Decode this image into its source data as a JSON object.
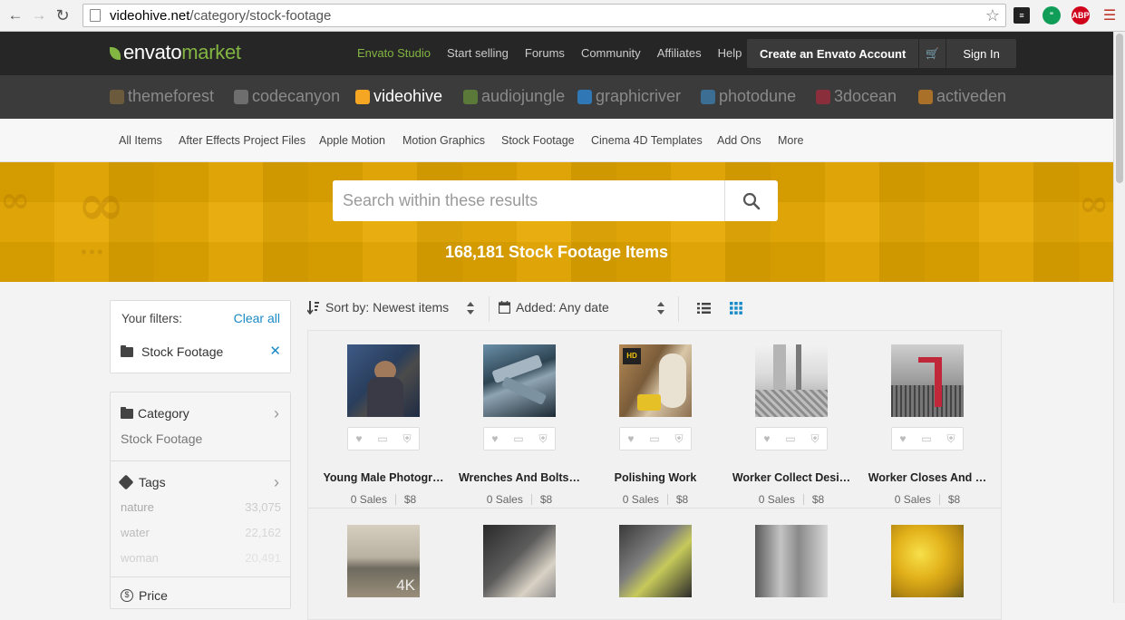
{
  "browser": {
    "url_host": "videohive.net",
    "url_path": "/category/stock-footage",
    "extensions": [
      "stack-icon",
      "hangouts-icon",
      "ABP",
      "menu-icon"
    ]
  },
  "topbar": {
    "logo_envato": "envato",
    "logo_market": "market",
    "links": [
      {
        "label": "Envato Studio",
        "active": true
      },
      {
        "label": "Start selling",
        "active": false
      },
      {
        "label": "Forums",
        "active": false
      },
      {
        "label": "Community",
        "active": false
      },
      {
        "label": "Affiliates",
        "active": false
      },
      {
        "label": "Help",
        "active": false
      }
    ],
    "create_account": "Create an Envato Account",
    "sign_in": "Sign In"
  },
  "marketplaces": [
    {
      "label": "themeforest",
      "color": "#6b5a3b"
    },
    {
      "label": "codecanyon",
      "color": "#6e6e6e"
    },
    {
      "label": "videohive",
      "color": "#f5a623",
      "active": true
    },
    {
      "label": "audiojungle",
      "color": "#5b7a3a"
    },
    {
      "label": "graphicriver",
      "color": "#2f77b5"
    },
    {
      "label": "photodune",
      "color": "#3c6e93"
    },
    {
      "label": "3docean",
      "color": "#8a2e3c"
    },
    {
      "label": "activeden",
      "color": "#a9702a"
    }
  ],
  "category_nav": [
    "All Items",
    "After Effects Project Files",
    "Apple Motion",
    "Motion Graphics",
    "Stock Footage",
    "Cinema 4D Templates",
    "Add Ons",
    "More"
  ],
  "hero": {
    "search_placeholder": "Search within these results",
    "count_text": "168,181 Stock Footage Items"
  },
  "filters": {
    "title": "Your filters:",
    "clear": "Clear all",
    "active": "Stock Footage"
  },
  "facets": {
    "category_title": "Category",
    "category_value": "Stock Footage",
    "tags_title": "Tags",
    "tags": [
      {
        "name": "nature",
        "count": "33,075"
      },
      {
        "name": "water",
        "count": "22,162"
      },
      {
        "name": "woman",
        "count": "20,491"
      }
    ],
    "price_title": "Price"
  },
  "sortbar": {
    "sort_label": "Sort by: Newest items",
    "date_label": "Added: Any date"
  },
  "items": [
    {
      "title": "Young Male Photogr…",
      "sales": "0 Sales",
      "price": "$8"
    },
    {
      "title": "Wrenches And Bolts…",
      "sales": "0 Sales",
      "price": "$8"
    },
    {
      "title": "Polishing Work",
      "sales": "0 Sales",
      "price": "$8"
    },
    {
      "title": "Worker Collect Desi…",
      "sales": "0 Sales",
      "price": "$8"
    },
    {
      "title": "Worker Closes And …",
      "sales": "0 Sales",
      "price": "$8"
    }
  ],
  "row2_badge": "4K"
}
